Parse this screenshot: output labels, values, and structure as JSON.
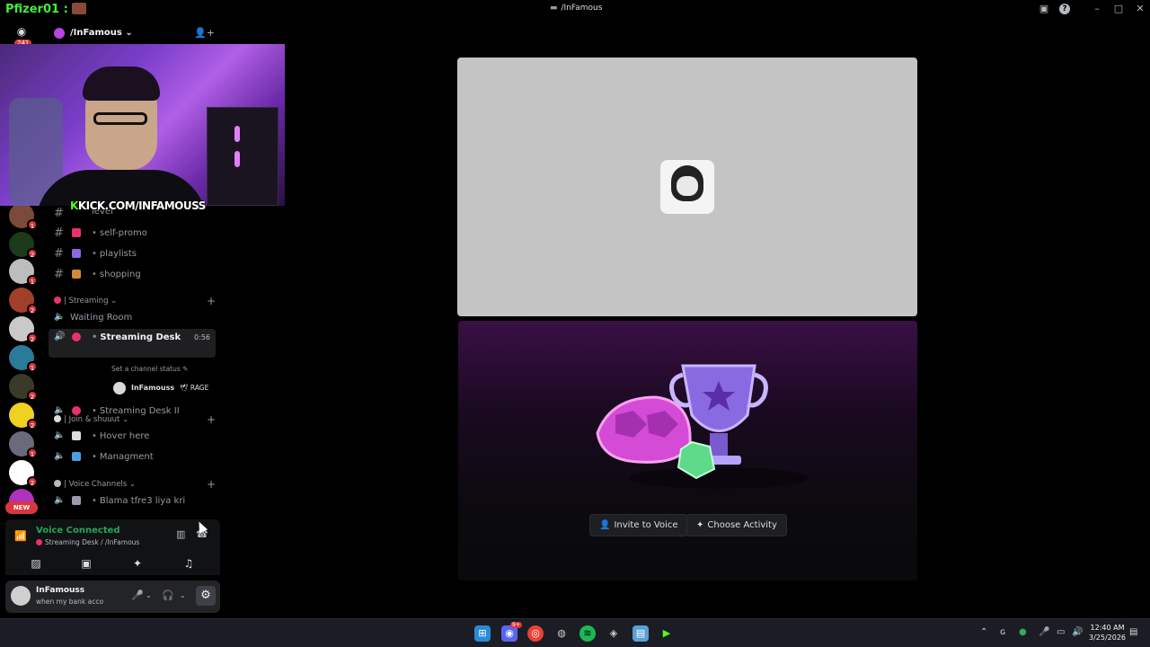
{
  "window": {
    "title": "/InFamous",
    "overlay_username": "Pfizer01 :"
  },
  "rail": {
    "home_badge": "241",
    "servers": [
      {
        "color": "#7a4a3a",
        "badge": "1"
      },
      {
        "color": "#1a3a1a",
        "badge": "2"
      },
      {
        "color": "#bdbdbd",
        "badge": "1"
      },
      {
        "color": "#a0402a",
        "badge": "2"
      },
      {
        "color": "#c9c9c9",
        "badge": "2"
      },
      {
        "color": "#2a7a9a",
        "badge": "1"
      },
      {
        "color": "#3a3a2a",
        "badge": "2"
      },
      {
        "color": "#f0d020",
        "badge": "2"
      },
      {
        "color": "#6a6a7a",
        "badge": "1"
      },
      {
        "color": "#ffffff",
        "badge": "2"
      },
      {
        "color": "#b030c0",
        "badge": ""
      }
    ],
    "new_label": "NEW"
  },
  "server": {
    "name": "/InFamous"
  },
  "webcam": {
    "overlay_text": "KICK.COM/INFAMOUSS",
    "overlay_k": "K"
  },
  "channels": {
    "partial_top": "level",
    "text": [
      {
        "name": "self-promo",
        "emoji_color": "#e8336a"
      },
      {
        "name": "playlists",
        "emoji_color": "#8a6adf"
      },
      {
        "name": "shopping",
        "emoji_color": "#d08a3a"
      }
    ],
    "cat_streaming": "| Streaming",
    "waiting_room": "Waiting Room",
    "streaming_desk": "Streaming Desk",
    "streaming_desk_timer": "0:56",
    "set_status": "Set a channel status",
    "vc_user_name": "InFamouss",
    "vc_user_tag": "RAGE",
    "streaming_desk_2": "Streaming Desk II",
    "cat_join": "| Join & shuuut",
    "hover_here": "Hover here",
    "managment": "Managment",
    "cat_voice": "| Voice Channels",
    "blama": "Blama tfre3 liya kri"
  },
  "voice": {
    "title": "Voice Connected",
    "sub": "Streaming Desk / /InFamous"
  },
  "user": {
    "name": "InFamouss",
    "status": "when my bank acco"
  },
  "stage": {
    "invite_label": "Invite to Voice",
    "activity_label": "Choose Activity"
  },
  "taskbar": {
    "time": "12:40 AM",
    "date": "3/25/2026",
    "discord_badge": "9+"
  }
}
